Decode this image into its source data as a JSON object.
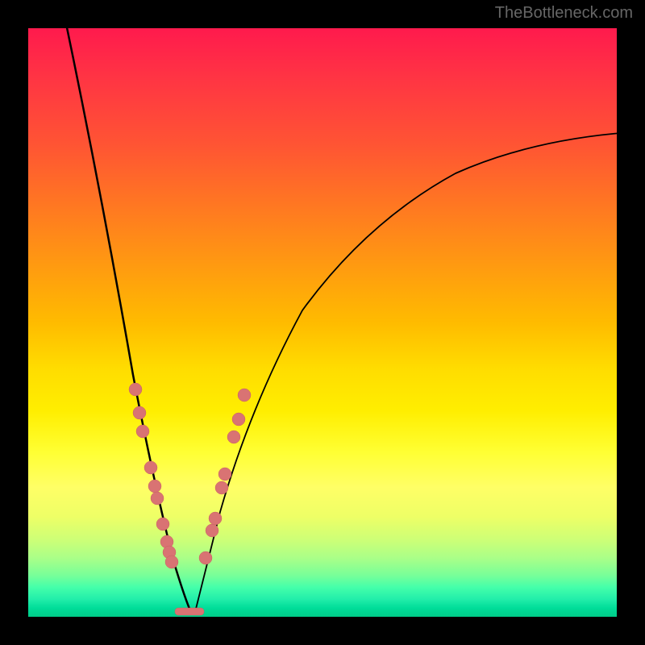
{
  "watermark": "TheBottleneck.com",
  "chart_data": {
    "type": "line",
    "title": "",
    "xlabel": "",
    "ylabel": "",
    "xlim": [
      0,
      100
    ],
    "ylim": [
      0,
      100
    ],
    "curve_shape": "V-shaped bottleneck curve with asymmetric arms - left arm steeper than right arm",
    "minimum_x": 27,
    "minimum_y": 0,
    "left_arm": {
      "start": {
        "x": 6,
        "y": 100
      },
      "end": {
        "x": 27,
        "y": 0
      }
    },
    "right_arm": {
      "start": {
        "x": 27,
        "y": 0
      },
      "end": {
        "x": 100,
        "y": 75
      }
    },
    "marked_points_left": [
      {
        "x": 18,
        "y": 38
      },
      {
        "x": 19,
        "y": 34
      },
      {
        "x": 19.5,
        "y": 31
      },
      {
        "x": 21,
        "y": 25
      },
      {
        "x": 21.8,
        "y": 22
      },
      {
        "x": 22.3,
        "y": 20
      },
      {
        "x": 23,
        "y": 16
      },
      {
        "x": 23.7,
        "y": 13
      },
      {
        "x": 24,
        "y": 11.5
      },
      {
        "x": 24.5,
        "y": 9.5
      }
    ],
    "marked_points_right": [
      {
        "x": 30,
        "y": 10
      },
      {
        "x": 31,
        "y": 15
      },
      {
        "x": 31.5,
        "y": 17
      },
      {
        "x": 32.5,
        "y": 22
      },
      {
        "x": 33,
        "y": 24.5
      },
      {
        "x": 34.5,
        "y": 31
      },
      {
        "x": 35.3,
        "y": 34
      },
      {
        "x": 36.3,
        "y": 38
      }
    ],
    "bottom_line_segment": {
      "start_x": 25,
      "end_x": 29,
      "y": 0.5
    },
    "background_gradient": {
      "type": "vertical",
      "stops": [
        {
          "color": "#ff1a4d",
          "position": 0
        },
        {
          "color": "#ff9911",
          "position": 40
        },
        {
          "color": "#ffff33",
          "position": 72
        },
        {
          "color": "#00cc88",
          "position": 100
        }
      ]
    }
  }
}
